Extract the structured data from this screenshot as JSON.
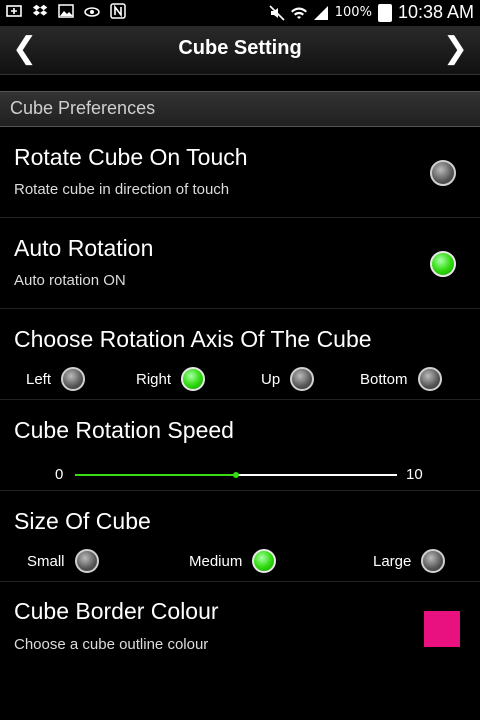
{
  "status_bar": {
    "battery": "100%",
    "time": "10:38 AM",
    "icons_left": [
      "add-icon",
      "dropbox-icon",
      "image-icon",
      "eye-icon",
      "nfc-icon"
    ],
    "icons_right": [
      "mute-icon",
      "wifi-icon",
      "signal-icon",
      "battery-icon"
    ]
  },
  "action_bar": {
    "title": "Cube Setting",
    "prev": "❮",
    "next": "❯"
  },
  "section": {
    "header": "Cube Preferences"
  },
  "rotate_on_touch": {
    "title": "Rotate Cube On Touch",
    "subtitle": "Rotate cube in direction of touch",
    "checked": false
  },
  "auto_rotation": {
    "title": "Auto Rotation",
    "subtitle": "Auto rotation ON",
    "checked": true
  },
  "rotation_axis": {
    "title": "Choose Rotation Axis Of The Cube",
    "options": [
      {
        "label": "Left",
        "selected": false
      },
      {
        "label": "Right",
        "selected": true
      },
      {
        "label": "Up",
        "selected": false
      },
      {
        "label": "Bottom",
        "selected": false
      }
    ]
  },
  "rotation_speed": {
    "title": "Cube Rotation Speed",
    "min": "0",
    "max": "10",
    "value": 5
  },
  "cube_size": {
    "title": "Size Of Cube",
    "options": [
      {
        "label": "Small",
        "selected": false
      },
      {
        "label": "Medium",
        "selected": true
      },
      {
        "label": "Large",
        "selected": false
      }
    ]
  },
  "border_colour": {
    "title": "Cube Border Colour",
    "subtitle": "Choose a cube outline colour",
    "color": "#e8117f"
  },
  "colors": {
    "accent_green": "#33dd11",
    "background": "#000000"
  }
}
